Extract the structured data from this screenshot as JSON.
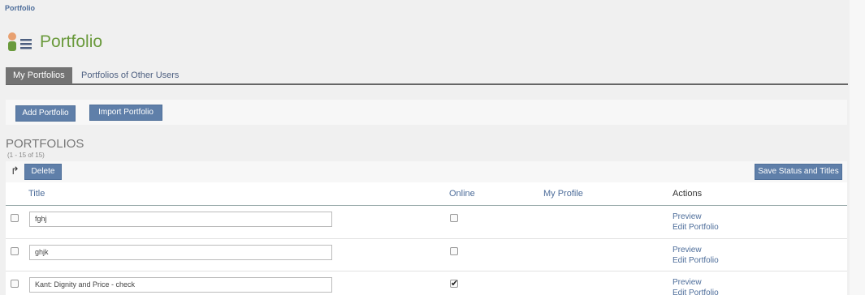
{
  "breadcrumb": "Portfolio",
  "header": {
    "title": "Portfolio",
    "icon": "user-list-icon"
  },
  "tabs": [
    {
      "label": "My Portfolios",
      "active": true
    },
    {
      "label": "Portfolios of Other Users",
      "active": false
    }
  ],
  "toolbar": {
    "add_label": "Add Portfolio",
    "import_label": "Import Portfolio"
  },
  "list": {
    "heading": "PORTFOLIOS",
    "count": "(1 - 15 of 15)",
    "delete_label": "Delete",
    "save_label": "Save Status and Titles",
    "columns": {
      "title": "Title",
      "online": "Online",
      "profile": "My Profile",
      "actions": "Actions"
    },
    "rows": [
      {
        "title": "fghj",
        "online": false,
        "preview": "Preview",
        "edit": "Edit Portfolio"
      },
      {
        "title": "ghjk",
        "online": false,
        "preview": "Preview",
        "edit": "Edit Portfolio"
      },
      {
        "title": "Kant: Dignity and Price - check",
        "online": true,
        "preview": "Preview",
        "edit": "Edit Portfolio"
      }
    ]
  },
  "colors": {
    "button": "#5f7fa9",
    "title_green": "#6a9a3c",
    "link": "#4d6d9a"
  }
}
